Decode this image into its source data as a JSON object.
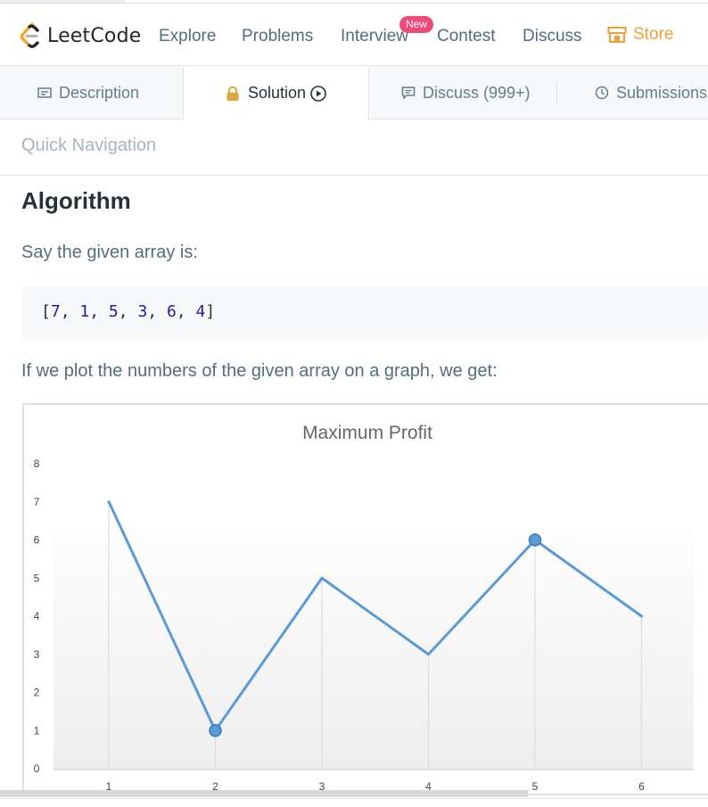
{
  "header": {
    "logo_text": "LeetCode",
    "nav": [
      {
        "label": "Explore"
      },
      {
        "label": "Problems"
      },
      {
        "label": "Interview"
      },
      {
        "label": "Contest"
      },
      {
        "label": "Discuss"
      },
      {
        "label": "Store",
        "icon": "store-icon"
      }
    ],
    "new_badge": "New",
    "colors": {
      "store": "#f29d38",
      "badge": "#ef4a78"
    }
  },
  "tabs": [
    {
      "label": "Description",
      "icon": "description-icon"
    },
    {
      "label": "Solution",
      "icon": "lock-icon",
      "active": true,
      "trailing_icon": "play-circle-icon"
    },
    {
      "label": "Discuss (999+)",
      "icon": "comment-icon"
    },
    {
      "label": "Submissions",
      "icon": "clock-icon"
    }
  ],
  "content": {
    "quick_navigation": "Quick Navigation",
    "heading": "Algorithm",
    "paragraph1": "Say the given array is:",
    "code": {
      "open": "[",
      "values": [
        "7",
        "1",
        "5",
        "3",
        "6",
        "4"
      ],
      "close": "]",
      "separator": ", "
    },
    "paragraph2": "If we plot the numbers of the given array on a graph, we get:"
  },
  "chart_data": {
    "type": "line",
    "title": "Maximum Profit",
    "x": [
      1,
      2,
      3,
      4,
      5,
      6
    ],
    "values": [
      7,
      1,
      5,
      3,
      6,
      4
    ],
    "highlighted_points": [
      2,
      5
    ],
    "ylim": [
      0,
      8
    ],
    "yticks": [
      0,
      1,
      2,
      3,
      4,
      5,
      6,
      7,
      8
    ],
    "xticks": [
      "1",
      "2",
      "3",
      "4",
      "5",
      "6"
    ],
    "xlabel": "",
    "ylabel": "",
    "grid": "vertical drop lines",
    "line_color": "#5b9bd5"
  }
}
